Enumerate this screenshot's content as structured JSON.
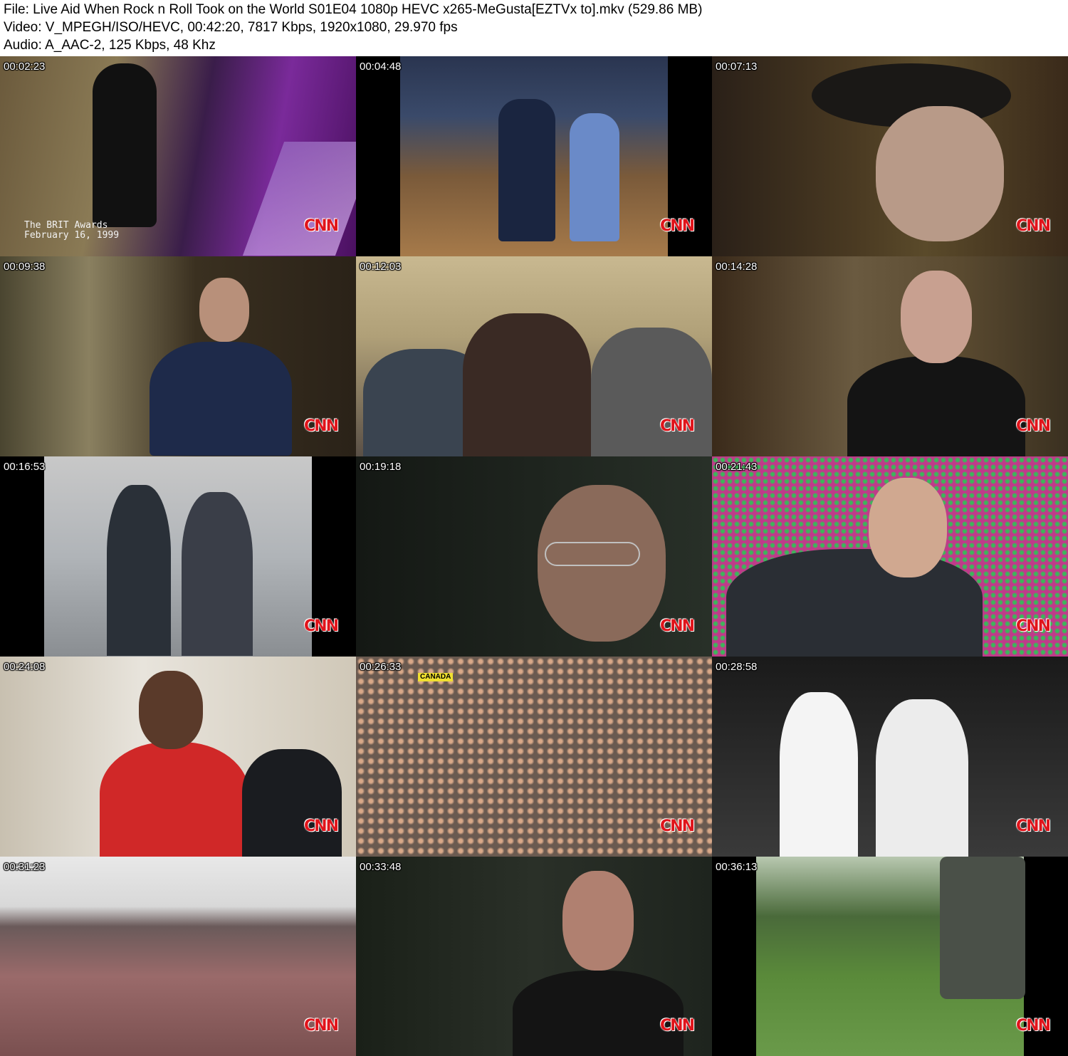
{
  "header": {
    "file_line": "File: Live Aid When Rock n Roll Took on the World S01E04 1080p HEVC x265-MeGusta[EZTVx to].mkv (529.86 MB)",
    "video_line": "Video: V_MPEGH/ISO/HEVC, 00:42:20, 7817 Kbps, 1920x1080, 29.970 fps",
    "audio_line": "Audio: A_AAC-2, 125 Kbps, 48 Khz"
  },
  "logo_text": "CNN",
  "thumbnails": [
    {
      "timestamp": "00:02:23",
      "caption_line1": "The BRIT Awards",
      "caption_line2": "February 16, 1999"
    },
    {
      "timestamp": "00:04:48"
    },
    {
      "timestamp": "00:07:13"
    },
    {
      "timestamp": "00:09:38"
    },
    {
      "timestamp": "00:12:03"
    },
    {
      "timestamp": "00:14:28"
    },
    {
      "timestamp": "00:16:53"
    },
    {
      "timestamp": "00:19:18"
    },
    {
      "timestamp": "00:21:43"
    },
    {
      "timestamp": "00:24:08"
    },
    {
      "timestamp": "00:26:33",
      "overlay_label": "CANADA"
    },
    {
      "timestamp": "00:28:58"
    },
    {
      "timestamp": "00:31:23"
    },
    {
      "timestamp": "00:33:48"
    },
    {
      "timestamp": "00:36:13"
    }
  ],
  "colors": {
    "background": "#ffffff",
    "logo_red": "#e0141b"
  }
}
